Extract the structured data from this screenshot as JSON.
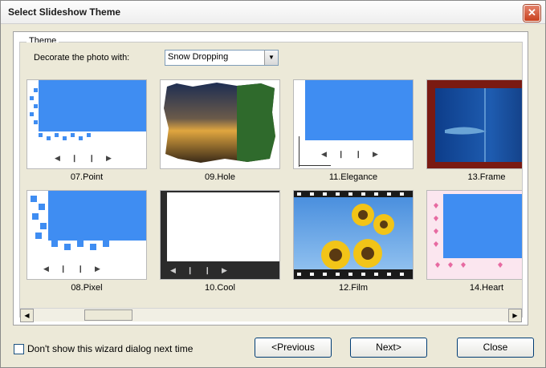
{
  "window": {
    "title": "Select Slideshow Theme",
    "close_glyph": "✕"
  },
  "group": {
    "legend": "Theme"
  },
  "decorate": {
    "label": "Decorate the photo with:",
    "value": "Snow Dropping",
    "arrow": "▼"
  },
  "themes": [
    {
      "label": "07.Point"
    },
    {
      "label": "09.Hole"
    },
    {
      "label": "11.Elegance"
    },
    {
      "label": "13.Frame"
    },
    {
      "label": "08.Pixel"
    },
    {
      "label": "10.Cool"
    },
    {
      "label": "12.Film"
    },
    {
      "label": "14.Heart"
    }
  ],
  "player_controls": "◀❙❙▶",
  "scrollbar": {
    "left_arrow": "◀",
    "right_arrow": "▶"
  },
  "footer": {
    "checkbox_label": "Don't show this wizard dialog next time",
    "checked": false,
    "previous_label": "<Previous",
    "next_label": "Next>",
    "close_label": "Close"
  },
  "colors": {
    "accent_blue": "#3f8df2",
    "title_close_red": "#c9421f"
  }
}
